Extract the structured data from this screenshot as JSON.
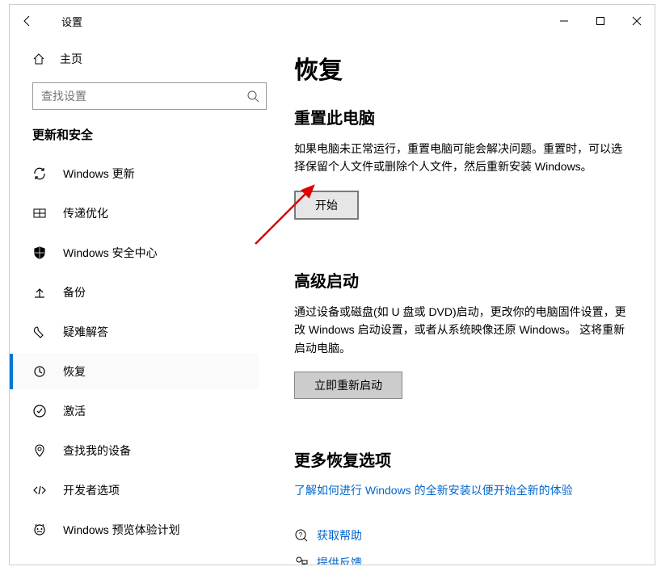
{
  "titlebar": {
    "title": "设置"
  },
  "sidebar": {
    "home": "主页",
    "search_placeholder": "查找设置",
    "category": "更新和安全",
    "items": [
      {
        "label": "Windows 更新",
        "icon": "sync-icon"
      },
      {
        "label": "传递优化",
        "icon": "delivery-icon"
      },
      {
        "label": "Windows 安全中心",
        "icon": "shield-icon"
      },
      {
        "label": "备份",
        "icon": "backup-icon"
      },
      {
        "label": "疑难解答",
        "icon": "troubleshoot-icon"
      },
      {
        "label": "恢复",
        "icon": "recovery-icon",
        "selected": true
      },
      {
        "label": "激活",
        "icon": "activation-icon"
      },
      {
        "label": "查找我的设备",
        "icon": "find-device-icon"
      },
      {
        "label": "开发者选项",
        "icon": "developer-icon"
      },
      {
        "label": "Windows 预览体验计划",
        "icon": "insider-icon"
      }
    ]
  },
  "main": {
    "title": "恢复",
    "reset": {
      "heading": "重置此电脑",
      "desc": "如果电脑未正常运行，重置电脑可能会解决问题。重置时，可以选择保留个人文件或删除个人文件，然后重新安装 Windows。",
      "button": "开始"
    },
    "advanced": {
      "heading": "高级启动",
      "desc": "通过设备或磁盘(如 U 盘或 DVD)启动，更改你的电脑固件设置，更改 Windows 启动设置，或者从系统映像还原 Windows。 这将重新启动电脑。",
      "button": "立即重新启动"
    },
    "more": {
      "heading": "更多恢复选项",
      "link": "了解如何进行 Windows 的全新安装以便开始全新的体验"
    },
    "help": {
      "get_help": "获取帮助",
      "feedback": "提供反馈"
    }
  }
}
